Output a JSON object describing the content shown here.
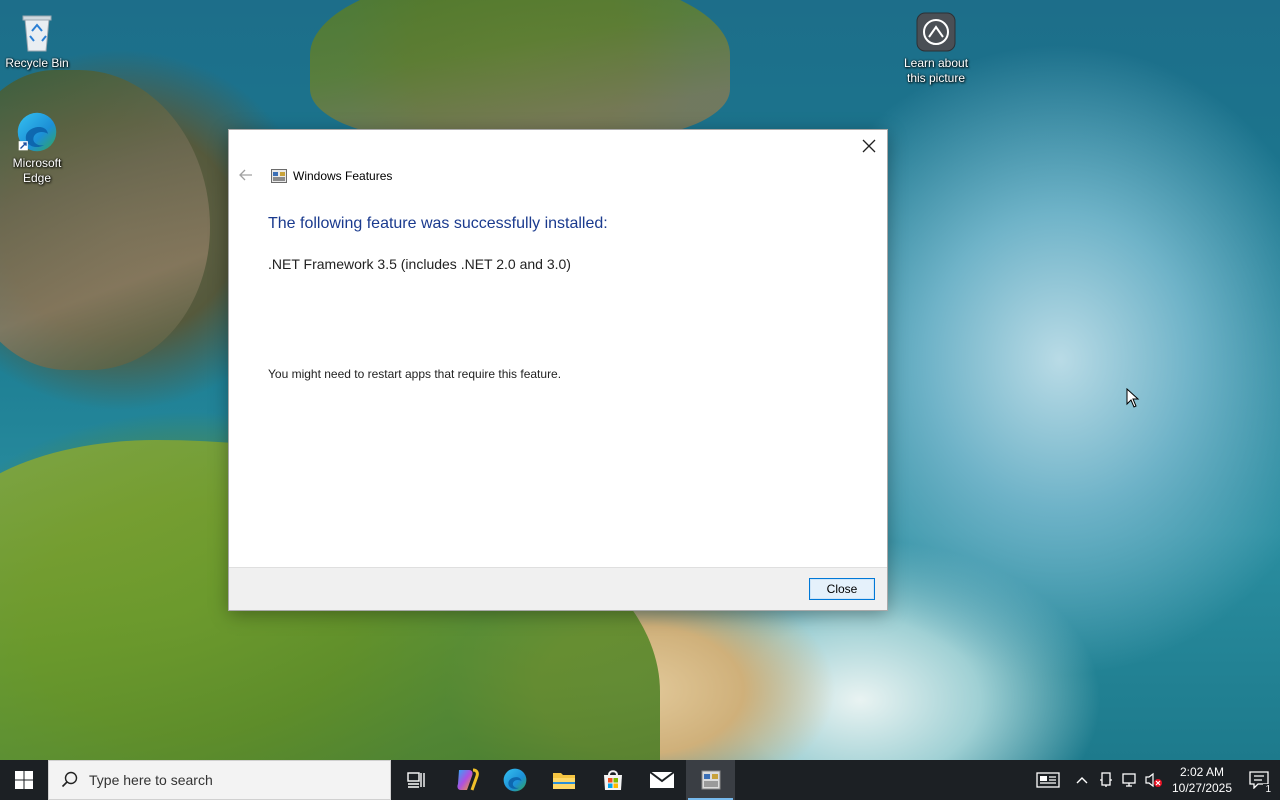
{
  "desktop": {
    "icons": [
      {
        "label": "Recycle Bin",
        "icon": "recycle-bin-icon"
      },
      {
        "label": "Microsoft Edge",
        "icon": "edge-icon"
      },
      {
        "label": "Learn about this picture",
        "icon": "learn-about-picture-icon"
      }
    ]
  },
  "dialog": {
    "title": "Windows Features",
    "heading": "The following feature was successfully installed:",
    "feature": ".NET Framework 3.5 (includes .NET 2.0 and 3.0)",
    "note": "You might need to restart apps that require this feature.",
    "close_button": "Close",
    "accent_color": "#1a3a8e"
  },
  "taskbar": {
    "search_placeholder": "Type here to search",
    "apps": [
      {
        "name": "task-view",
        "icon": "task-view-icon"
      },
      {
        "name": "copilot",
        "icon": "copilot-icon"
      },
      {
        "name": "edge",
        "icon": "edge-icon"
      },
      {
        "name": "file-explorer",
        "icon": "folder-icon"
      },
      {
        "name": "microsoft-store",
        "icon": "store-icon"
      },
      {
        "name": "mail",
        "icon": "mail-icon"
      },
      {
        "name": "windows-features",
        "icon": "windows-features-icon",
        "active": true
      }
    ],
    "tray": {
      "time": "2:02 AM",
      "date": "10/27/2025",
      "notification_count": "1"
    }
  }
}
